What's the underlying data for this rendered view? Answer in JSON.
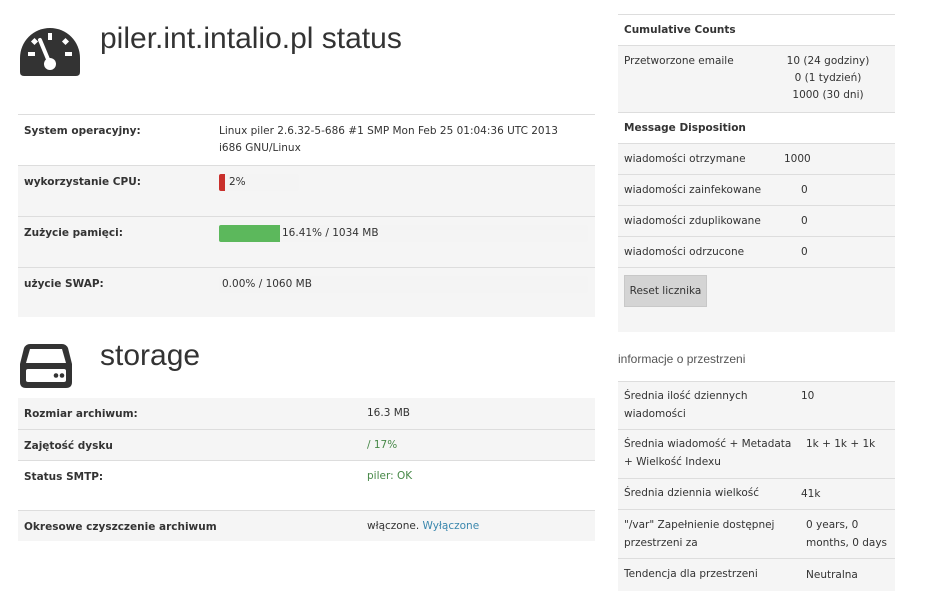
{
  "status": {
    "title": "piler.int.intalio.pl status",
    "rows": {
      "os": {
        "label": "System operacyjny:",
        "value": "Linux piler 2.6.32-5-686 #1 SMP Mon Feb 25 01:04:36 UTC 2013 i686 GNU/Linux"
      },
      "cpu": {
        "label": "wykorzystanie CPU:",
        "value": "2%",
        "fraction": 0.02,
        "color": "#c9302c"
      },
      "mem": {
        "label": "Zużycie pamięci:",
        "value": "16.41% / 1034 MB",
        "fraction": 0.1641,
        "color": "#5cb85c"
      },
      "swap": {
        "label": "użycie SWAP:",
        "value": "0.00% / 1060 MB",
        "fraction": 0.0
      }
    }
  },
  "storage": {
    "title": "storage",
    "rows": {
      "archive_size": {
        "label": "Rozmiar archiwum:",
        "value": "16.3 MB"
      },
      "disk": {
        "label": "Zajętość dysku",
        "value": "/ 17%"
      },
      "smtp": {
        "label": "Status SMTP:",
        "value": "piler: OK"
      },
      "cleanup": {
        "label": "Okresowe czyszczenie archiwum",
        "value": "włączone.",
        "link": "Wyłączone"
      }
    }
  },
  "counts": {
    "title": "Cumulative Counts",
    "processed_label": "Przetworzone emaile",
    "processed_values": [
      "10 (24 godziny)",
      "0 (1 tydzień)",
      "1000 (30 dni)"
    ]
  },
  "disposition": {
    "title": "Message Disposition",
    "rows": [
      {
        "label": "wiadomości otrzymane",
        "value": "1000"
      },
      {
        "label": "wiadomości zainfekowane",
        "value": "0"
      },
      {
        "label": "wiadomości zduplikowane",
        "value": "0"
      },
      {
        "label": "wiadomości odrzucone",
        "value": "0"
      }
    ],
    "reset_label": "Reset licznika"
  },
  "space": {
    "title": "informacje o przestrzeni",
    "rows": [
      {
        "label": "Średnia ilość dziennych wiadomości",
        "value": "10"
      },
      {
        "label": "Średnia wiadomość + Metadata + Wielkość Indexu",
        "value": "1k + 1k + 1k"
      },
      {
        "label": "Średnia dziennia wielkość",
        "value": "41k"
      },
      {
        "label": "\"/var\" Zapełnienie dostępnej przestrzeni za",
        "value": "0 years, 0 months, 0 days"
      },
      {
        "label": "Tendencja dla przestrzeni",
        "value": "Neutralna"
      }
    ]
  }
}
